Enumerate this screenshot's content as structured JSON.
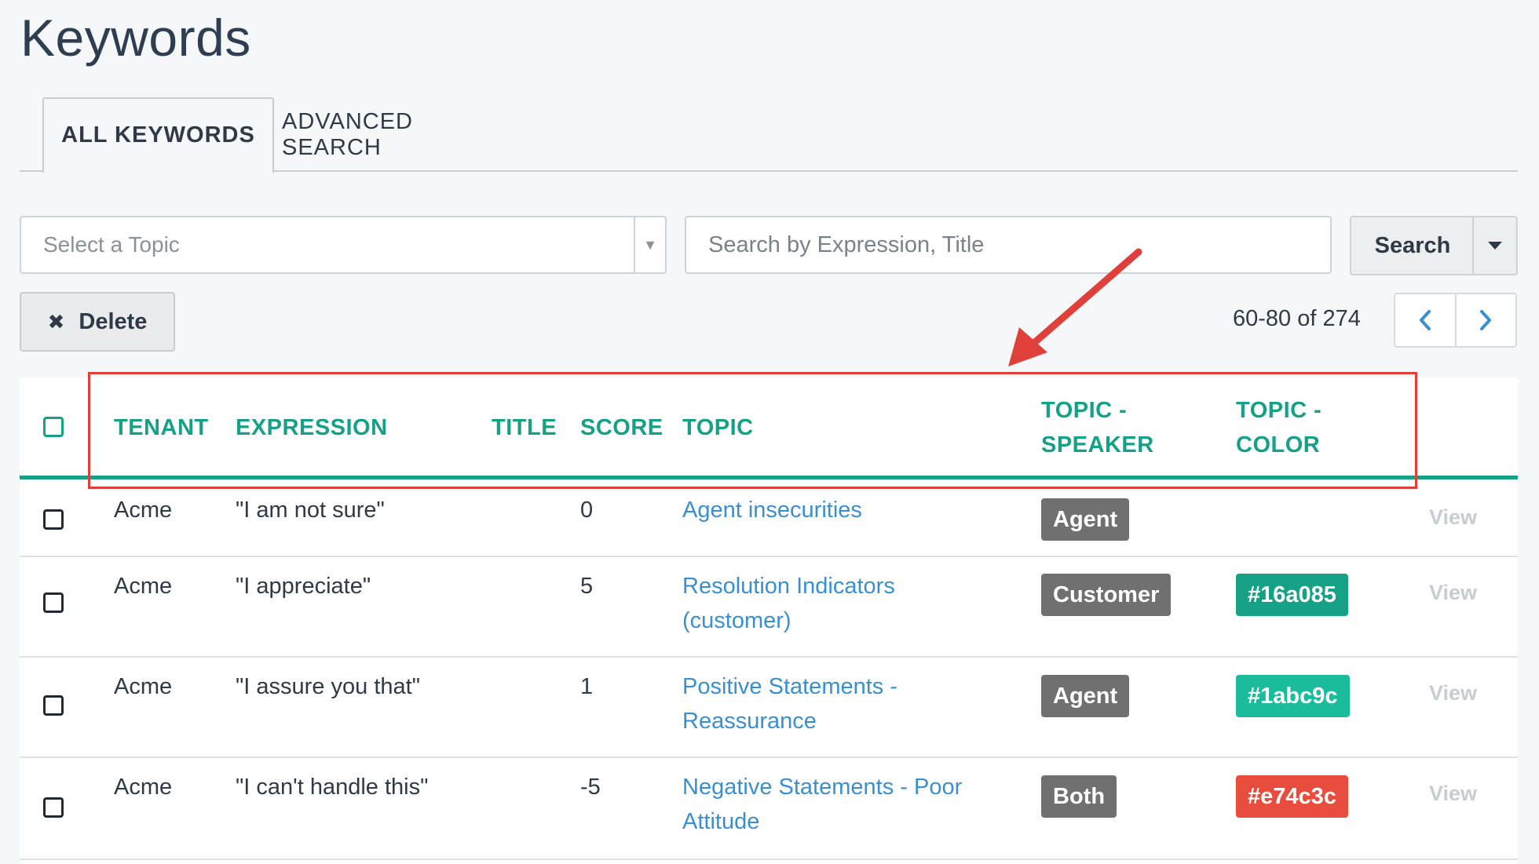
{
  "page": {
    "title": "Keywords"
  },
  "tabs": [
    {
      "label": "ALL KEYWORDS",
      "active": true
    },
    {
      "label": "ADVANCED SEARCH",
      "active": false
    }
  ],
  "filters": {
    "topic_placeholder": "Select a Topic",
    "search_placeholder": "Search by Expression, Title",
    "search_label": "Search"
  },
  "toolbar": {
    "delete_label": "Delete"
  },
  "pager": {
    "range_text": "60-80 of 274"
  },
  "table": {
    "headers": {
      "tenant": "TENANT",
      "expression": "EXPRESSION",
      "title": "TITLE",
      "score": "SCORE",
      "topic": "TOPIC",
      "speaker_1": "TOPIC -",
      "speaker_2": "SPEAKER",
      "color_1": "TOPIC -",
      "color_2": "COLOR"
    },
    "view_label": "View",
    "rows": [
      {
        "tenant": "Acme",
        "expression": "\"I am not sure\"",
        "title": "",
        "score": "0",
        "topic_1": "Agent insecurities",
        "topic_2": "",
        "speaker": "Agent",
        "color": ""
      },
      {
        "tenant": "Acme",
        "expression": "\"I appreciate\"",
        "title": "",
        "score": "5",
        "topic_1": "Resolution Indicators",
        "topic_2": "(customer)",
        "speaker": "Customer",
        "color": "#16a085"
      },
      {
        "tenant": "Acme",
        "expression": "\"I assure you that\"",
        "title": "",
        "score": "1",
        "topic_1": "Positive Statements -",
        "topic_2": "Reassurance",
        "speaker": "Agent",
        "color": "#1abc9c"
      },
      {
        "tenant": "Acme",
        "expression": "\"I can't handle this\"",
        "title": "",
        "score": "-5",
        "topic_1": "Negative Statements - Poor",
        "topic_2": "Attitude",
        "speaker": "Both",
        "color": "#e74c3c"
      }
    ]
  },
  "theme": {
    "accent": "#16a085",
    "link": "#3a8fd0",
    "annotation": "#e0403a"
  }
}
